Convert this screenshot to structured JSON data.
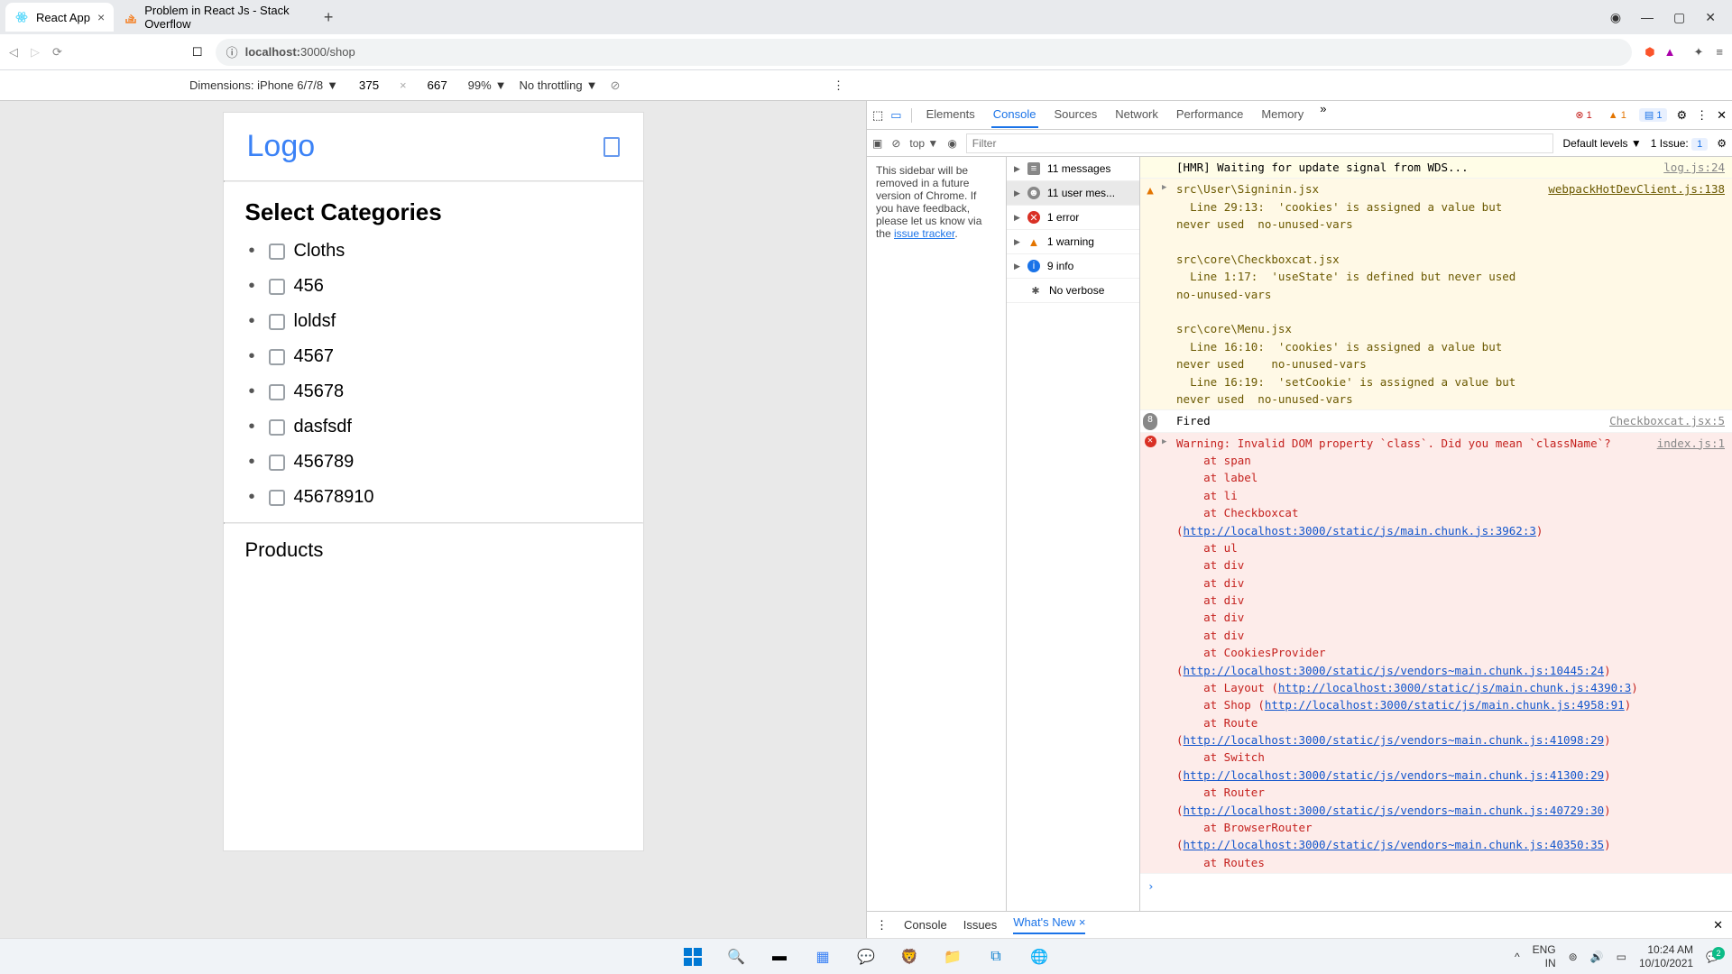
{
  "browser": {
    "tabs": [
      {
        "title": "React App",
        "favicon": "react"
      },
      {
        "title": "Problem in React Js - Stack Overflow",
        "favicon": "so"
      }
    ],
    "url_prefix": "localhost:",
    "url_suffix": "3000/shop"
  },
  "device_bar": {
    "label": "Dimensions: iPhone 6/7/8",
    "width": "375",
    "height": "667",
    "zoom": "99%",
    "throttling": "No throttling"
  },
  "page": {
    "logo": "Logo",
    "section_title": "Select Categories",
    "categories": [
      "Cloths",
      "456",
      "loldsf",
      "4567",
      "45678",
      "dasfsdf",
      "456789",
      "45678910"
    ],
    "products_title": "Products"
  },
  "devtools": {
    "tabs": [
      "Elements",
      "Console",
      "Sources",
      "Network",
      "Performance",
      "Memory"
    ],
    "active_tab": "Console",
    "top_badges": {
      "errors": "1",
      "warnings": "1",
      "messages": "1"
    },
    "filter": {
      "context": "top",
      "placeholder": "Filter",
      "levels": "Default levels",
      "issues": "1 Issue:",
      "issues_count": "1"
    },
    "sidebar_notice": {
      "text": "This sidebar will be removed in a future version of Chrome. If you have feedback, please let us know via the ",
      "link": "issue tracker"
    },
    "summary": [
      {
        "icon": "msg",
        "text": "11 messages"
      },
      {
        "icon": "user",
        "text": "11 user mes..."
      },
      {
        "icon": "err",
        "text": "1 error"
      },
      {
        "icon": "warn",
        "text": "1 warning"
      },
      {
        "icon": "info",
        "text": "9 info"
      },
      {
        "icon": "verbose",
        "text": "No verbose"
      }
    ],
    "console": {
      "hmr": {
        "text": "[HMR] Waiting for update signal from WDS...",
        "src": "log.js:24"
      },
      "warn_block": {
        "src": "webpackHotDevClient.js:138",
        "lines": [
          "src\\User\\Signinin.jsx",
          "  Line 29:13:  'cookies' is assigned a value but never used  no-unused-vars",
          "",
          "src\\core\\Checkboxcat.jsx",
          "  Line 1:17:  'useState' is defined but never used  no-unused-vars",
          "",
          "src\\core\\Menu.jsx",
          "  Line 16:10:  'cookies' is assigned a value but never used    no-unused-vars",
          "  Line 16:19:  'setCookie' is assigned a value but never used  no-unused-vars"
        ]
      },
      "fired": {
        "count": "8",
        "text": "Fired",
        "src": "Checkboxcat.jsx:5"
      },
      "error": {
        "head": "Warning: Invalid DOM property `class`. Did you mean `className`?",
        "src": "index.js:1",
        "stack": [
          "at span",
          "at label",
          "at li",
          "at Checkboxcat (http://localhost:3000/static/js/main.chunk.js:3962:3)",
          "at ul",
          "at div",
          "at div",
          "at div",
          "at div",
          "at div",
          "at CookiesProvider (http://localhost:3000/static/js/vendors~main.chunk.js:10445:24)",
          "at Layout (http://localhost:3000/static/js/main.chunk.js:4390:3)",
          "at Shop (http://localhost:3000/static/js/main.chunk.js:4958:91)",
          "at Route (http://localhost:3000/static/js/vendors~main.chunk.js:41098:29)",
          "at Switch (http://localhost:3000/static/js/vendors~main.chunk.js:41300:29)",
          "at Router (http://localhost:3000/static/js/vendors~main.chunk.js:40729:30)",
          "at BrowserRouter (http://localhost:3000/static/js/vendors~main.chunk.js:40350:35)",
          "at Routes"
        ]
      }
    },
    "drawer": {
      "tabs": [
        "Console",
        "Issues",
        "What's New"
      ],
      "active": "What's New"
    }
  },
  "taskbar": {
    "lang1": "ENG",
    "lang2": "IN",
    "time": "10:24 AM",
    "date": "10/10/2021",
    "notif": "2"
  }
}
